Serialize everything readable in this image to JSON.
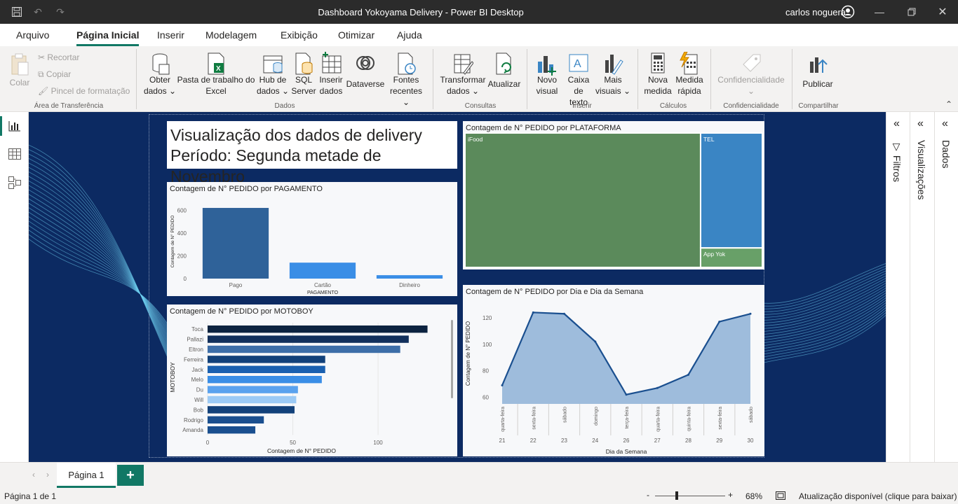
{
  "app": {
    "window_title": "Dashboard Yokoyama Delivery - Power BI Desktop",
    "user_name": "carlos noguera"
  },
  "menu": {
    "tabs": [
      "Arquivo",
      "Página Inicial",
      "Inserir",
      "Modelagem",
      "Exibição",
      "Otimizar",
      "Ajuda"
    ],
    "active": "Página Inicial"
  },
  "ribbon": {
    "clipboard": {
      "paste": "Colar",
      "cut": "Recortar",
      "copy": "Copiar",
      "format_painter": "Pincel de formatação",
      "group": "Área de Transferência"
    },
    "data": {
      "get_data": [
        "Obter",
        "dados"
      ],
      "excel": [
        "Pasta de trabalho do",
        "Excel"
      ],
      "hub": [
        "Hub de",
        "dados"
      ],
      "sql": [
        "SQL",
        "Server"
      ],
      "enter": [
        "Inserir",
        "dados"
      ],
      "dataverse": "Dataverse",
      "recent": [
        "Fontes",
        "recentes"
      ],
      "group": "Dados"
    },
    "queries": {
      "transform": [
        "Transformar",
        "dados"
      ],
      "refresh": "Atualizar",
      "group": "Consultas"
    },
    "insert": {
      "new_visual": [
        "Novo",
        "visual"
      ],
      "textbox": [
        "Caixa de",
        "texto"
      ],
      "more_visuals": [
        "Mais",
        "visuais"
      ],
      "group": "Inserir"
    },
    "calc": {
      "new_measure": [
        "Nova",
        "medida"
      ],
      "quick_measure": [
        "Medida",
        "rápida"
      ],
      "group": "Cálculos"
    },
    "sensitivity": {
      "label": "Confidencialidade",
      "group": "Confidencialidade"
    },
    "share": {
      "publish": "Publicar",
      "group": "Compartilhar"
    }
  },
  "report": {
    "title_line1": "Visualização dos dados de delivery",
    "title_line2": "Período: Segunda metade de Novembro"
  },
  "colors": {
    "canvas_bg": "#0c2a62",
    "accent": "#117865"
  },
  "chart_data": [
    {
      "id": "pagamento",
      "type": "bar",
      "title": "Contagem de N° PEDIDO por PAGAMENTO",
      "xlabel": "PAGAMENTO",
      "ylabel": "Contagem de N° PEDIDO",
      "categories": [
        "Pago",
        "Cartão",
        "Dinheiro"
      ],
      "values": [
        620,
        140,
        30
      ],
      "ylim": [
        0,
        700
      ],
      "yticks": [
        0,
        200,
        400,
        600
      ],
      "colors": [
        "#2f6299",
        "#3a8ee6",
        "#3a8ee6"
      ]
    },
    {
      "id": "motoboy",
      "type": "bar",
      "orientation": "horizontal",
      "title": "Contagem de N° PEDIDO por MOTOBOY",
      "xlabel": "Contagem de N° PEDIDO",
      "ylabel": "MOTOBOY",
      "categories": [
        "Toca",
        "Pallazi",
        "Eltron",
        "Ferreira",
        "Jack",
        "Melo",
        "Du",
        "Will",
        "Bob",
        "Rodrigo",
        "Amanda"
      ],
      "values": [
        129,
        118,
        113,
        69,
        69,
        67,
        53,
        52,
        51,
        33,
        28
      ],
      "xlim": [
        0,
        130
      ],
      "xticks": [
        0,
        50,
        100
      ],
      "colors": [
        "#0c2340",
        "#12305c",
        "#3d6ea8",
        "#12417a",
        "#1a60b0",
        "#3a8ee6",
        "#5aa2ee",
        "#9ccaf5",
        "#12417a",
        "#1a4f8f",
        "#1a4f8f"
      ]
    },
    {
      "id": "plataforma",
      "type": "treemap",
      "title": "Contagem de N° PEDIDO por PLATAFORMA",
      "categories": [
        "iFood",
        "TEL",
        "App Yok"
      ],
      "values": [
        580,
        130,
        22
      ],
      "colors": [
        "#5b8a5b",
        "#3a85c4",
        "#68a068"
      ]
    },
    {
      "id": "dia",
      "type": "area",
      "title": "Contagem de N° PEDIDO por Dia e Dia da Semana",
      "xlabel": "Dia da Semana",
      "ylabel": "Contagem de N° PEDIDO",
      "x": [
        "21",
        "22",
        "23",
        "24",
        "26",
        "27",
        "28",
        "29",
        "30"
      ],
      "weekdays": [
        "quarta-feira",
        "sexta-feira",
        "sábado",
        "domingo",
        "terça-feira",
        "quarta-feira",
        "quinta-feira",
        "sexta-feira",
        "sábado"
      ],
      "values": [
        69,
        124,
        123,
        102,
        62,
        67,
        77,
        117,
        123
      ],
      "ylim": [
        55,
        130
      ],
      "yticks": [
        60,
        80,
        100,
        120
      ]
    }
  ],
  "panes": {
    "filters": "Filtros",
    "visualizations": "Visualizações",
    "data": "Dados"
  },
  "page_tabs": {
    "current": "Página 1"
  },
  "status": {
    "page_info": "Página 1 de 1",
    "zoom": "68%",
    "update": "Atualização disponível (clique para baixar)"
  }
}
